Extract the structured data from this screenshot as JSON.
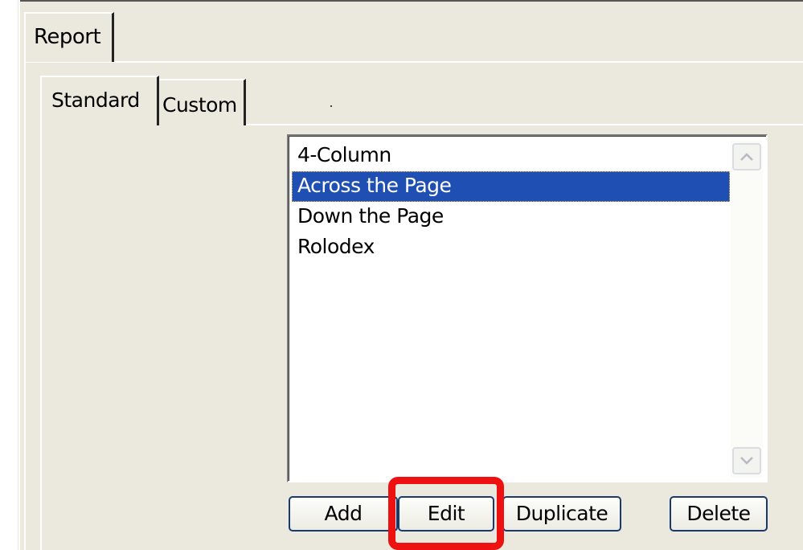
{
  "tabs": {
    "outer": [
      {
        "label": "Report"
      }
    ],
    "inner": [
      {
        "label": "Standard"
      },
      {
        "label": "Custom"
      }
    ]
  },
  "list": {
    "items": [
      {
        "label": "4-Column"
      },
      {
        "label": "Across the Page"
      },
      {
        "label": "Down the Page"
      },
      {
        "label": "Rolodex"
      }
    ],
    "selected_index": 1
  },
  "buttons": {
    "add": "Add",
    "edit": "Edit",
    "duplicate": "Duplicate",
    "delete": "Delete"
  },
  "highlight": {
    "target": "edit-button",
    "color": "#ee1111"
  },
  "colors": {
    "dialog_bg": "#ebe9dd",
    "selection_bg": "#1f4fb3",
    "button_border": "#1a3a6e"
  },
  "icons": {
    "scroll_up": "chevron-up-icon",
    "scroll_down": "chevron-down-icon"
  }
}
